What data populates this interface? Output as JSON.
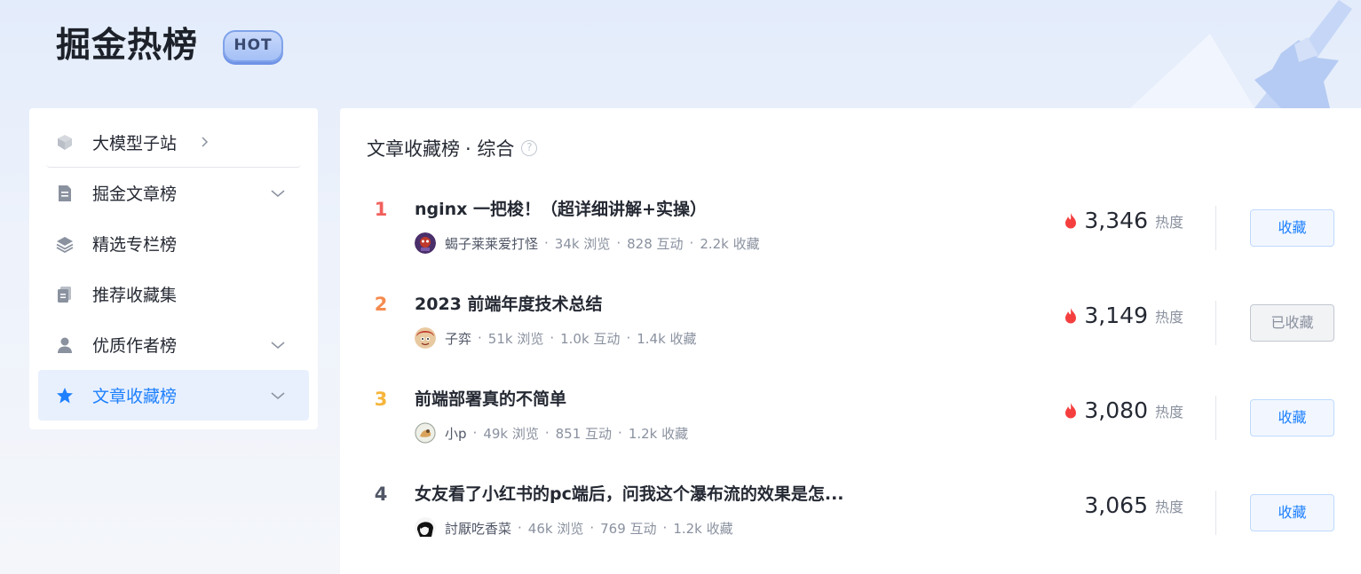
{
  "header": {
    "logo": "掘金热榜",
    "badge": "HOT"
  },
  "sidebar": {
    "items": [
      {
        "label": "大模型子站",
        "icon": "cube-icon",
        "chevron": "right"
      },
      {
        "label": "掘金文章榜",
        "icon": "document-icon",
        "chevron": "down"
      },
      {
        "label": "精选专栏榜",
        "icon": "layers-icon",
        "chevron": ""
      },
      {
        "label": "推荐收藏集",
        "icon": "collection-icon",
        "chevron": ""
      },
      {
        "label": "优质作者榜",
        "icon": "user-icon",
        "chevron": "down"
      },
      {
        "label": "文章收藏榜",
        "icon": "star-icon",
        "chevron": "down",
        "active": true
      }
    ]
  },
  "main": {
    "title": "文章收藏榜",
    "subtitle": "· 综合",
    "help": "?",
    "hot_label": "热度",
    "rows": [
      {
        "rank": "1",
        "title": "nginx 一把梭！（超详细讲解+实操）",
        "author": "蝎子莱莱爱打怪",
        "views": "34k 浏览",
        "interactions": "828 互动",
        "collects": "2.2k 收藏",
        "heat": "3,346",
        "hot": true,
        "button": "收藏",
        "collected": false
      },
      {
        "rank": "2",
        "title": "2023 前端年度技术总结",
        "author": "子弈",
        "views": "51k 浏览",
        "interactions": "1.0k 互动",
        "collects": "1.4k 收藏",
        "heat": "3,149",
        "hot": true,
        "button": "已收藏",
        "collected": true
      },
      {
        "rank": "3",
        "title": "前端部署真的不简单",
        "author": "小p",
        "views": "49k 浏览",
        "interactions": "851 互动",
        "collects": "1.2k 收藏",
        "heat": "3,080",
        "hot": true,
        "button": "收藏",
        "collected": false
      },
      {
        "rank": "4",
        "title": "女友看了小红书的pc端后，问我这个瀑布流的效果是怎...",
        "author": "討厭吃香菜",
        "views": "46k 浏览",
        "interactions": "769 互动",
        "collects": "1.2k 收藏",
        "heat": "3,065",
        "hot": false,
        "button": "收藏",
        "collected": false
      }
    ]
  },
  "colors": {
    "accent": "#1e80ff",
    "rank1": "#f1605d",
    "rank2": "#f58b4f",
    "rank3": "#f5b53b",
    "flame": "#f53f3f"
  }
}
